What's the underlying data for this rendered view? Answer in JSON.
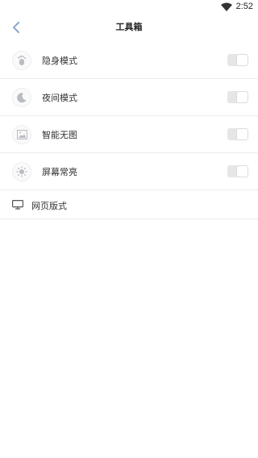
{
  "status_bar": {
    "time": "2:52",
    "wifi_icon": "wifi-icon"
  },
  "header": {
    "title": "工具箱",
    "back_icon": "chevron-left-icon",
    "accent": "#8aa8c8"
  },
  "settings": [
    {
      "label": "隐身模式",
      "icon": "footprint-icon",
      "enabled": false
    },
    {
      "label": "夜间模式",
      "icon": "moon-icon",
      "enabled": false
    },
    {
      "label": "智能无图",
      "icon": "image-icon",
      "enabled": false
    },
    {
      "label": "屏幕常亮",
      "icon": "brightness-icon",
      "enabled": false
    }
  ],
  "web_layout": {
    "label": "网页版式",
    "icon": "monitor-icon"
  },
  "colors": {
    "toggle_off": "#e6e6e6",
    "icon_gray": "#b9bcc2",
    "divider": "#ececec"
  }
}
